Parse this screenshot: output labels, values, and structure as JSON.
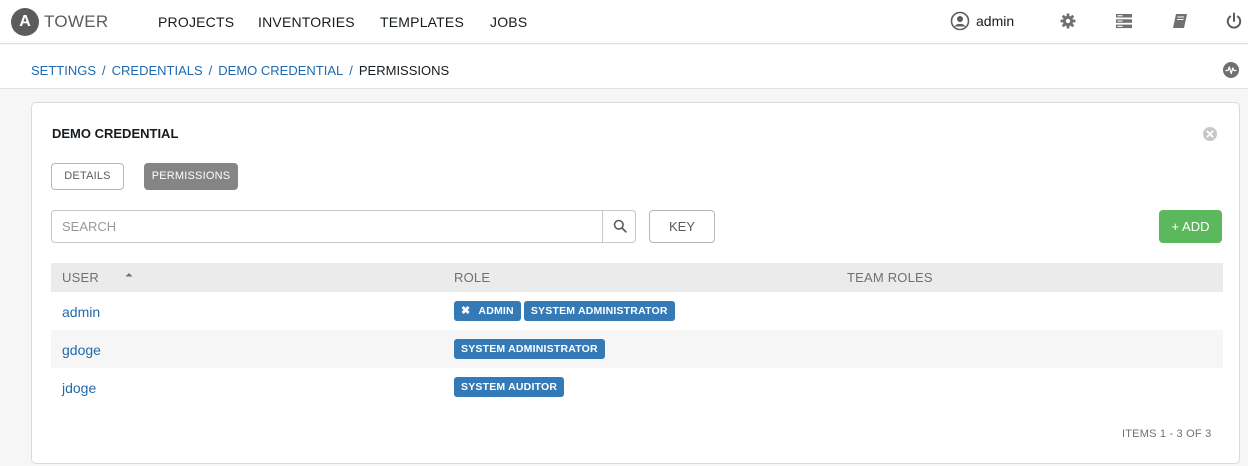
{
  "brand": {
    "logo_letter": "A",
    "name": "TOWER"
  },
  "nav": {
    "projects": "PROJECTS",
    "inventories": "INVENTORIES",
    "templates": "TEMPLATES",
    "jobs": "JOBS",
    "username": "admin",
    "icons": [
      "user-circle-icon",
      "gear-icon",
      "server-icon",
      "book-icon",
      "power-icon"
    ]
  },
  "breadcrumb": {
    "settings": "SETTINGS",
    "credentials": "CREDENTIALS",
    "demo_credential": "DEMO CREDENTIAL",
    "current": "PERMISSIONS",
    "separator": "/"
  },
  "panel": {
    "title": "DEMO CREDENTIAL",
    "tabs": {
      "details": "DETAILS",
      "permissions": "PERMISSIONS"
    },
    "search": {
      "placeholder": "SEARCH",
      "value": ""
    },
    "key_label": "KEY",
    "add_label": "+ ADD"
  },
  "table": {
    "headers": {
      "user": "USER",
      "role": "ROLE",
      "team_roles": "TEAM ROLES"
    },
    "sort": {
      "column": "user",
      "direction": "ascending"
    },
    "rows": [
      {
        "user": "admin",
        "roles": [
          "ADMIN",
          "SYSTEM ADMINISTRATOR"
        ],
        "removable_role": "ADMIN"
      },
      {
        "user": "gdoge",
        "roles": [
          "SYSTEM ADMINISTRATOR"
        ]
      },
      {
        "user": "jdoge",
        "roles": [
          "SYSTEM AUDITOR"
        ]
      }
    ]
  },
  "pagination": "ITEMS  1 - 3 OF 3",
  "colors": {
    "link": "#1f6ab0",
    "badge": "#337ab7",
    "add_button": "#5cb85c",
    "active_tab": "#858585"
  }
}
